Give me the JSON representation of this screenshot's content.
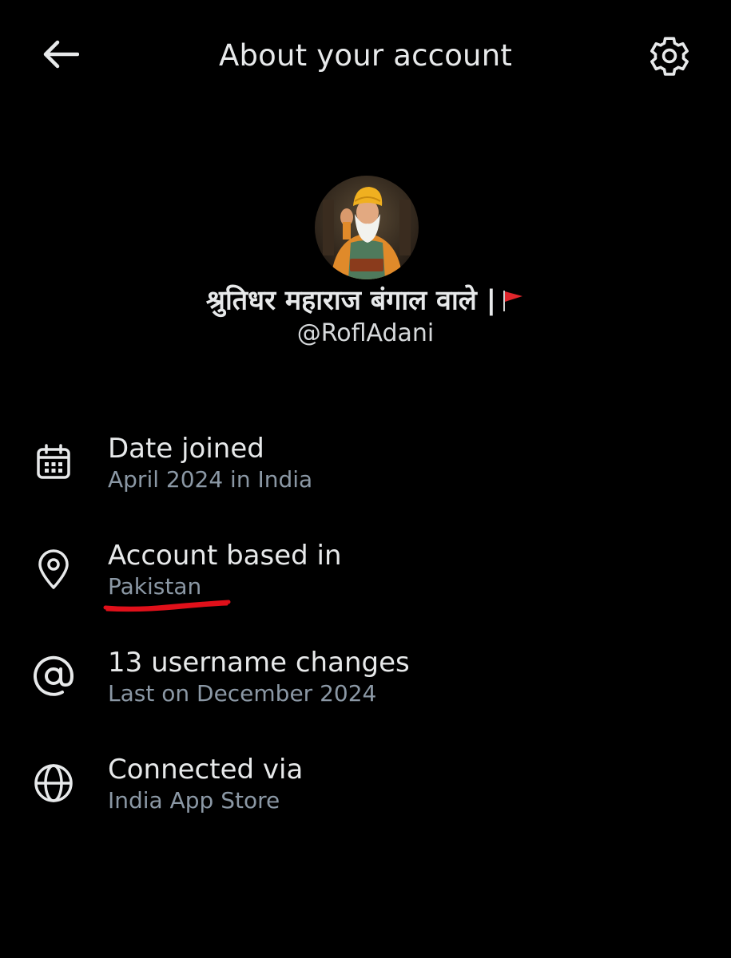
{
  "header": {
    "title": "About your account",
    "back_icon": "arrow-left-icon",
    "settings_icon": "gear-icon"
  },
  "profile": {
    "display_name": "श्रुतिधर महाराज बंगाल वाले |",
    "flag_icon": "red-flag-icon",
    "handle": "@RoflAdani"
  },
  "rows": [
    {
      "icon": "calendar-icon",
      "title": "Date joined",
      "subtitle": "April 2024 in India"
    },
    {
      "icon": "location-pin-icon",
      "title": "Account based in",
      "subtitle": "Pakistan"
    },
    {
      "icon": "at-sign-icon",
      "title": "13 username changes",
      "subtitle": "Last on December 2024"
    },
    {
      "icon": "globe-icon",
      "title": "Connected via",
      "subtitle": "India App Store"
    }
  ],
  "colors": {
    "background": "#000000",
    "primary_text": "#e7e9ea",
    "secondary_text": "#8b98a5",
    "annotation_underline": "#e0101a"
  }
}
